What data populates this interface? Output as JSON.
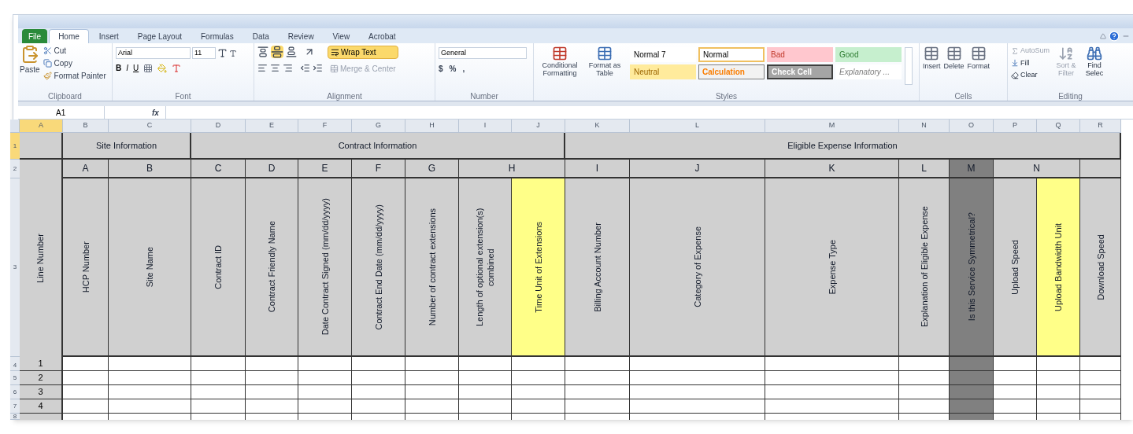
{
  "ribbon": {
    "tabs": [
      {
        "label": "File",
        "kind": "file",
        "selected": false
      },
      {
        "label": "Home",
        "kind": "tab",
        "selected": true
      },
      {
        "label": "Insert",
        "kind": "tab",
        "selected": false
      },
      {
        "label": "Page Layout",
        "kind": "tab",
        "selected": false
      },
      {
        "label": "Formulas",
        "kind": "tab",
        "selected": false
      },
      {
        "label": "Data",
        "kind": "tab",
        "selected": false
      },
      {
        "label": "Review",
        "kind": "tab",
        "selected": false
      },
      {
        "label": "View",
        "kind": "tab",
        "selected": false
      },
      {
        "label": "Acrobat",
        "kind": "tab",
        "selected": false
      }
    ],
    "clipboard": {
      "label": "Clipboard",
      "paste": "Paste",
      "cut": "Cut",
      "copy": "Copy",
      "format_painter": "Format Painter"
    },
    "font": {
      "label": "Font",
      "name": "Arial",
      "size": "11",
      "bold": "B",
      "italic": "I",
      "underline": "U"
    },
    "alignment": {
      "label": "Alignment",
      "middle_align_on": true,
      "wrap_text": {
        "label": "Wrap Text",
        "on": true
      },
      "merge": {
        "label": "Merge & Center",
        "disabled": true
      }
    },
    "number": {
      "label": "Number",
      "format": "General",
      "currency": "$",
      "percent": "%",
      "comma": ","
    },
    "styles": {
      "label": "Styles",
      "conditional": "Conditional Formatting",
      "format_table": "Format as Table",
      "gallery": [
        {
          "label": "Normal 7",
          "kind": "plain"
        },
        {
          "label": "Normal",
          "kind": "current"
        },
        {
          "label": "Bad",
          "kind": "bad"
        },
        {
          "label": "Good",
          "kind": "good"
        },
        {
          "label": "Neutral",
          "kind": "neutral"
        },
        {
          "label": "Calculation",
          "kind": "calculation"
        },
        {
          "label": "Check Cell",
          "kind": "check"
        },
        {
          "label": "Explanatory ...",
          "kind": "explanatory"
        }
      ]
    },
    "cells": {
      "label": "Cells",
      "buttons": [
        "Insert",
        "Delete",
        "Format"
      ]
    },
    "editing": {
      "label": "Editing",
      "autosum": {
        "label": "AutoSum",
        "disabled": true
      },
      "fill": {
        "label": "Fill",
        "disabled": false
      },
      "clear": {
        "label": "Clear",
        "disabled": false
      },
      "sort": {
        "label": "Sort & Filter",
        "disabled": true
      },
      "find": {
        "label": "Find Selec",
        "disabled": false
      }
    }
  },
  "formula_bar": {
    "name_box": "A1",
    "function_symbol": "fx"
  },
  "sheet": {
    "column_headers": [
      {
        "label": "A",
        "selected": true
      },
      {
        "label": "B",
        "selected": false
      },
      {
        "label": "C",
        "selected": false
      },
      {
        "label": "D",
        "selected": false
      },
      {
        "label": "E",
        "selected": false
      },
      {
        "label": "F",
        "selected": false
      },
      {
        "label": "G",
        "selected": false
      },
      {
        "label": "H",
        "selected": false
      },
      {
        "label": "I",
        "selected": false
      },
      {
        "label": "J",
        "selected": false
      },
      {
        "label": "K",
        "selected": false
      },
      {
        "label": "L",
        "selected": false
      },
      {
        "label": "M",
        "selected": false
      },
      {
        "label": "N",
        "selected": false
      },
      {
        "label": "O",
        "selected": false
      },
      {
        "label": "P",
        "selected": false
      },
      {
        "label": "Q",
        "selected": false
      },
      {
        "label": "R",
        "selected": false
      }
    ],
    "row_headers": [
      {
        "label": "1",
        "selected": true
      },
      {
        "label": "2",
        "selected": false
      },
      {
        "label": "3",
        "selected": false
      },
      {
        "label": "4",
        "selected": false
      },
      {
        "label": "5",
        "selected": false
      },
      {
        "label": "6",
        "selected": false
      },
      {
        "label": "7",
        "selected": false
      },
      {
        "label": "8",
        "selected": false
      }
    ],
    "line_column": {
      "title": "Line Number"
    },
    "groups": [
      {
        "label": "Site Information",
        "fields": [
          {
            "letter": "A",
            "columns": [
              {
                "title": "HCP Number",
                "kind": "standard"
              }
            ]
          },
          {
            "letter": "B",
            "columns": [
              {
                "title": "Site Name",
                "kind": "standard"
              }
            ]
          }
        ]
      },
      {
        "label": "Contract Information",
        "fields": [
          {
            "letter": "C",
            "columns": [
              {
                "title": "Contract ID",
                "kind": "standard"
              }
            ]
          },
          {
            "letter": "D",
            "columns": [
              {
                "title": "Contract Friendly Name",
                "kind": "standard"
              }
            ]
          },
          {
            "letter": "E",
            "columns": [
              {
                "title": "Date Contract Signed (mm/dd/yyyy)",
                "kind": "standard"
              }
            ]
          },
          {
            "letter": "F",
            "columns": [
              {
                "title": "Contract End Date (mm/dd/yyyy)",
                "kind": "standard"
              }
            ]
          },
          {
            "letter": "G",
            "columns": [
              {
                "title": "Number of contract extensions",
                "kind": "standard"
              }
            ]
          },
          {
            "letter": "H",
            "columns": [
              {
                "title": "Length of optional extension(s) combined",
                "kind": "standard"
              },
              {
                "title": "Time Unit of Extensions",
                "kind": "highlight"
              }
            ]
          }
        ]
      },
      {
        "label": "Eligible Expense Information",
        "fields": [
          {
            "letter": "I",
            "columns": [
              {
                "title": "Billing Account Number",
                "kind": "standard"
              }
            ]
          },
          {
            "letter": "J",
            "columns": [
              {
                "title": "Category of Expense",
                "kind": "standard"
              }
            ]
          },
          {
            "letter": "K",
            "columns": [
              {
                "title": "Expense Type",
                "kind": "standard"
              }
            ]
          },
          {
            "letter": "L",
            "columns": [
              {
                "title": "Explanation of Eligible Expense",
                "kind": "standard"
              }
            ]
          },
          {
            "letter": "M",
            "kind": "dark",
            "columns": [
              {
                "title": "Is this Service Symmetrical?",
                "kind": "dark"
              }
            ]
          },
          {
            "letter": "N",
            "columns": [
              {
                "title": "Upload Speed",
                "kind": "standard"
              },
              {
                "title": "Upload Bandwidth Unit",
                "kind": "highlight"
              }
            ]
          },
          {
            "columns": [
              {
                "title": "Download Speed",
                "kind": "standard"
              }
            ]
          }
        ]
      }
    ],
    "rows": [
      {
        "line": "1"
      },
      {
        "line": "2"
      },
      {
        "line": "3"
      },
      {
        "line": "4"
      }
    ]
  }
}
